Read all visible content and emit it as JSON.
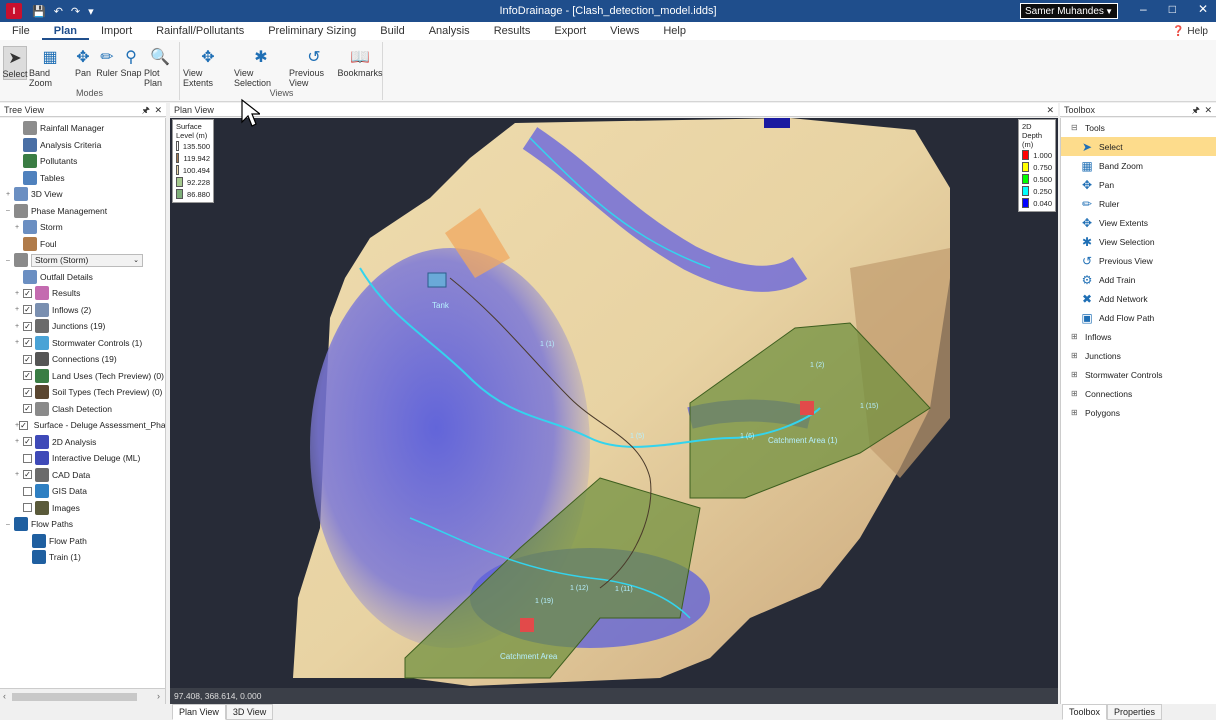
{
  "app": {
    "title": "InfoDrainage - [Clash_detection_model.idds]",
    "icon_label": "I",
    "user_name": "Samer Muhandes",
    "window_controls": [
      "–",
      "□",
      "✕"
    ]
  },
  "quick_access": [
    "save-icon",
    "undo-icon",
    "redo-icon",
    "customize-icon"
  ],
  "menu": {
    "tabs": [
      "File",
      "Plan",
      "Import",
      "Rainfall/Pollutants",
      "Preliminary Sizing",
      "Build",
      "Analysis",
      "Results",
      "Export",
      "Views",
      "Help"
    ],
    "active": "Plan",
    "help_label": "Help"
  },
  "ribbon": {
    "modes_label": "Modes",
    "views_label": "Views",
    "modes": [
      {
        "label": "Select",
        "icon": "cursor-icon"
      },
      {
        "label": "Band Zoom",
        "icon": "band-zoom-icon"
      },
      {
        "label": "Pan",
        "icon": "pan-icon"
      },
      {
        "label": "Ruler",
        "icon": "ruler-icon"
      },
      {
        "label": "Snap",
        "icon": "snap-icon"
      },
      {
        "label": "Plot Plan",
        "icon": "plot-plan-icon"
      }
    ],
    "views": [
      {
        "label": "View Extents",
        "icon": "view-extents-icon"
      },
      {
        "label": "View Selection",
        "icon": "view-selection-icon"
      },
      {
        "label": "Previous View",
        "icon": "previous-view-icon"
      },
      {
        "label": "Bookmarks",
        "icon": "bookmarks-icon"
      }
    ]
  },
  "tree_view": {
    "title": "Tree View",
    "items": [
      {
        "label": "Rainfall Manager",
        "indent": 1,
        "exp": "",
        "check": null,
        "color": "#8c8c8c"
      },
      {
        "label": "Analysis Criteria",
        "indent": 1,
        "exp": "",
        "check": null,
        "color": "#4a6fa5"
      },
      {
        "label": "Pollutants",
        "indent": 1,
        "exp": "",
        "check": null,
        "color": "#3a7d44"
      },
      {
        "label": "Tables",
        "indent": 1,
        "exp": "",
        "check": null,
        "color": "#4f81bd"
      },
      {
        "label": "3D View",
        "indent": 0,
        "exp": "+",
        "check": null,
        "color": "#6b8fc2"
      },
      {
        "label": "Phase Management",
        "indent": 0,
        "exp": "–",
        "check": null,
        "color": "#8a8a8a"
      },
      {
        "label": "Storm",
        "indent": 1,
        "exp": "+",
        "check": null,
        "color": "#6b8fc2"
      },
      {
        "label": "Foul",
        "indent": 1,
        "exp": "",
        "check": null,
        "color": "#b07b4a"
      },
      {
        "label": "Storm (Storm)",
        "indent": 0,
        "exp": "–",
        "check": null,
        "color": "#8a8a8a",
        "dropdown": true
      },
      {
        "label": "Outfall Details",
        "indent": 1,
        "exp": "",
        "check": null,
        "color": "#6b8fc2"
      },
      {
        "label": "Results",
        "indent": 1,
        "exp": "+",
        "check": true,
        "color": "#c46bb0"
      },
      {
        "label": "Inflows (2)",
        "indent": 1,
        "exp": "+",
        "check": true,
        "color": "#7a8fb0"
      },
      {
        "label": "Junctions (19)",
        "indent": 1,
        "exp": "+",
        "check": true,
        "color": "#6b6b6b"
      },
      {
        "label": "Stormwater Controls (1)",
        "indent": 1,
        "exp": "+",
        "check": true,
        "color": "#4aa3d6"
      },
      {
        "label": "Connections (19)",
        "indent": 1,
        "exp": "",
        "check": true,
        "color": "#555555"
      },
      {
        "label": "Land Uses (Tech Preview) (0)",
        "indent": 1,
        "exp": "",
        "check": true,
        "color": "#3a7d44"
      },
      {
        "label": "Soil Types (Tech Preview) (0)",
        "indent": 1,
        "exp": "",
        "check": true,
        "color": "#5a4630"
      },
      {
        "label": "Clash Detection",
        "indent": 1,
        "exp": "",
        "check": true,
        "color": "#8a8a8a"
      },
      {
        "label": "Surface - Deluge Assessment_Phas",
        "indent": 1,
        "exp": "+",
        "check": true,
        "color": "#5aa66b"
      },
      {
        "label": "2D Analysis",
        "indent": 1,
        "exp": "+",
        "check": true,
        "color": "#3f4ab8"
      },
      {
        "label": "Interactive Deluge (ML)",
        "indent": 1,
        "exp": "",
        "check": false,
        "color": "#3f4ab8"
      },
      {
        "label": "CAD Data",
        "indent": 1,
        "exp": "+",
        "check": true,
        "color": "#6b6b6b"
      },
      {
        "label": "GIS Data",
        "indent": 1,
        "exp": "",
        "check": false,
        "color": "#2e7fc2"
      },
      {
        "label": "Images",
        "indent": 1,
        "exp": "",
        "check": false,
        "color": "#5a5a3a"
      },
      {
        "label": "Flow Paths",
        "indent": 0,
        "exp": "–",
        "check": null,
        "color": "#1f5fa0"
      },
      {
        "label": "Flow Path",
        "indent": 2,
        "exp": "",
        "check": null,
        "color": "#1f5fa0"
      },
      {
        "label": "Train (1)",
        "indent": 2,
        "exp": "",
        "check": null,
        "color": "#1f5fa0"
      }
    ]
  },
  "plan_view": {
    "title": "Plan View",
    "coords": "97.408, 368.614, 0.000",
    "surface_legend": {
      "title_lines": [
        "Surface",
        "Level (m)"
      ],
      "entries": [
        {
          "value": "135.500",
          "color": "#ffffff"
        },
        {
          "value": "119.942",
          "color": "#a87c52"
        },
        {
          "value": "100.494",
          "color": "#efdcae"
        },
        {
          "value": "92.228",
          "color": "#a5c98e"
        },
        {
          "value": "86.880",
          "color": "#7fb07a"
        }
      ]
    },
    "depth_legend": {
      "title_lines": [
        "2D",
        "Depth (m)"
      ],
      "entries": [
        {
          "value": "1.000",
          "color": "#ff0000"
        },
        {
          "value": "0.750",
          "color": "#ffff00"
        },
        {
          "value": "0.500",
          "color": "#00ff00"
        },
        {
          "value": "0.250",
          "color": "#00ffff"
        },
        {
          "value": "0.040",
          "color": "#0000ff"
        }
      ]
    },
    "map_labels": [
      "Tank",
      "Catchment Area (1)",
      "Catchment Area",
      "1 (19)",
      "1 (12)",
      "1 (11)",
      "1 (2)",
      "1 (5)",
      "1 (6)",
      "1 (15)",
      "1 (1)"
    ]
  },
  "bottom_tabs": {
    "left": [
      "Plan View",
      "3D View"
    ],
    "right": [
      "Toolbox",
      "Properties"
    ]
  },
  "toolbox": {
    "title": "Toolbox",
    "tools_label": "Tools",
    "tools": [
      {
        "label": "Select",
        "icon": "cursor-icon",
        "selected": true
      },
      {
        "label": "Band Zoom",
        "icon": "band-zoom-icon"
      },
      {
        "label": "Pan",
        "icon": "pan-icon"
      },
      {
        "label": "Ruler",
        "icon": "ruler-icon"
      },
      {
        "label": "View Extents",
        "icon": "view-extents-icon"
      },
      {
        "label": "View Selection",
        "icon": "view-selection-icon"
      },
      {
        "label": "Previous View",
        "icon": "previous-view-icon"
      },
      {
        "label": "Add Train",
        "icon": "add-train-icon"
      },
      {
        "label": "Add Network",
        "icon": "add-network-icon"
      },
      {
        "label": "Add Flow Path",
        "icon": "add-flow-path-icon"
      }
    ],
    "categories": [
      "Inflows",
      "Junctions",
      "Stormwater Controls",
      "Connections",
      "Polygons"
    ]
  }
}
